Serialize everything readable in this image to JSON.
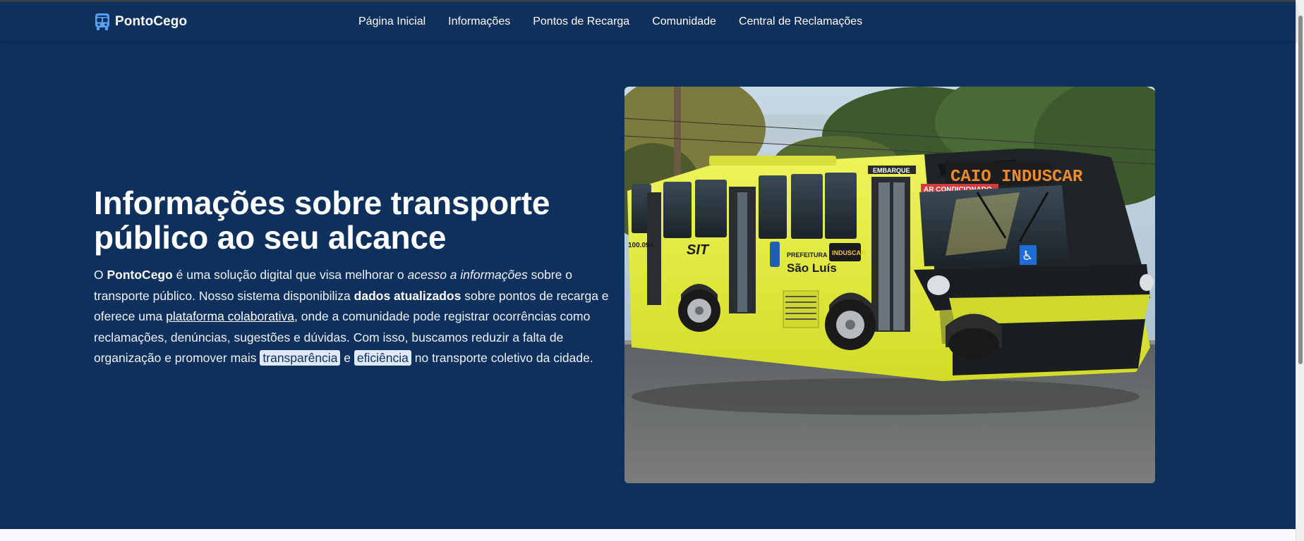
{
  "brand": {
    "name": "PontoCego",
    "icon": "bus-icon",
    "icon_color": "#5aa0f2"
  },
  "nav": {
    "items": [
      {
        "label": "Página Inicial"
      },
      {
        "label": "Informações"
      },
      {
        "label": "Pontos de Recarga"
      },
      {
        "label": "Comunidade"
      },
      {
        "label": "Central de Reclamações"
      }
    ]
  },
  "hero": {
    "title": "Informações sobre transporte público ao seu alcance",
    "desc": {
      "t1": "O ",
      "brand": "PontoCego",
      "t2": " é uma solução digital que visa melhorar o ",
      "em": "acesso a informações",
      "t3": " sobre o transporte público. Nosso sistema disponibiliza ",
      "strong": "dados atualizados",
      "t4": " sobre pontos de recarga e oferece uma ",
      "link": "plataforma colaborativa",
      "t5": ", onde a comunidade pode registrar ocorrências como reclamações, denúncias, sugestões e dúvidas. Com isso, buscamos reduzir a falta de organização e promover mais ",
      "pill1": "transparência",
      "t6": " e ",
      "pill2": "eficiência",
      "t7": " no transporte coletivo da cidade."
    },
    "image": {
      "sign": "CAIO INDUSCAR",
      "ac_label": "AR CONDICIONADO",
      "embarque": "EMBARQUE",
      "sit": "SIT",
      "prefeitura": "PREFEITURA DE",
      "city": "São Luís",
      "fleet": "100.094",
      "tag": "INDUSCAR"
    }
  },
  "colors": {
    "navy": "#0e305c",
    "bus_yellow": "#e7f03a",
    "pill_bg": "#dfe9f9"
  }
}
